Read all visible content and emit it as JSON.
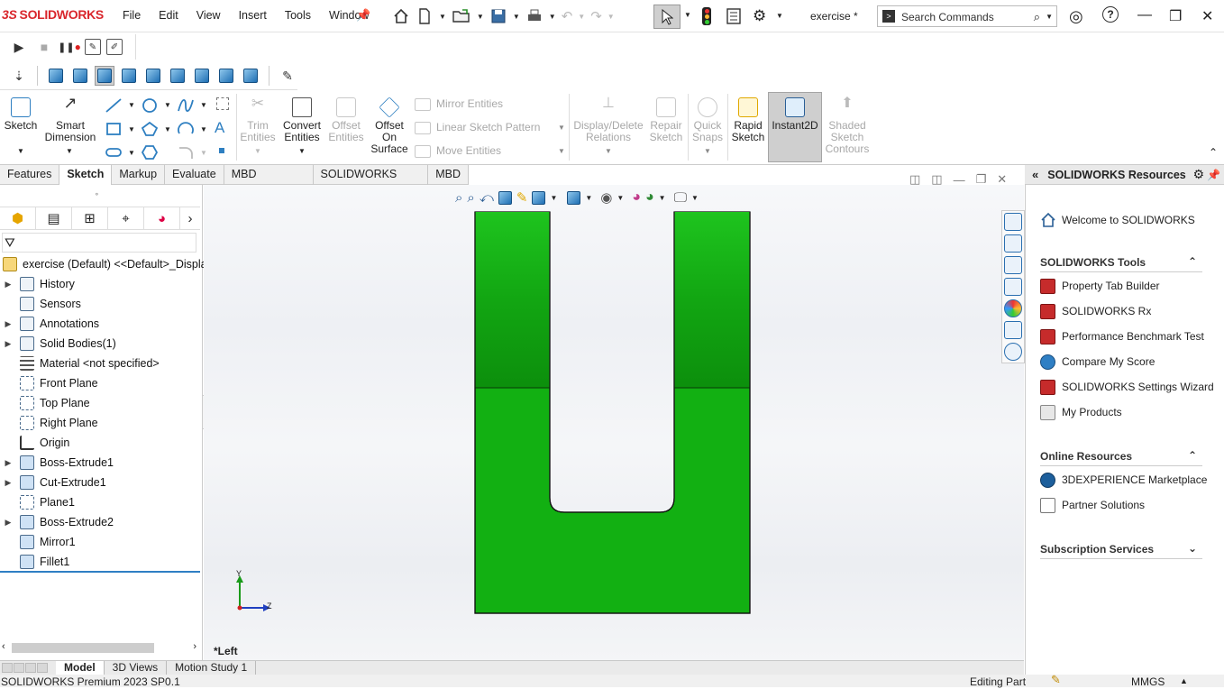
{
  "app": {
    "brand": "SOLIDWORKS",
    "brand_prefix": "3S",
    "document_title": "exercise *"
  },
  "menu": [
    "File",
    "Edit",
    "View",
    "Insert",
    "Tools",
    "Window"
  ],
  "search": {
    "placeholder": "Search Commands"
  },
  "command_manager": {
    "sketch": "Sketch",
    "smart_dimension": [
      "Smart",
      "Dimension"
    ],
    "trim_entities": [
      "Trim",
      "Entities"
    ],
    "convert_entities": [
      "Convert",
      "Entities"
    ],
    "offset_entities": [
      "Offset",
      "Entities"
    ],
    "offset_on_surface": [
      "Offset",
      "On",
      "Surface"
    ],
    "mirror_entities": "Mirror Entities",
    "linear_sketch_pattern": "Linear Sketch Pattern",
    "move_entities": "Move Entities",
    "display_delete_relations": [
      "Display/Delete",
      "Relations"
    ],
    "repair_sketch": [
      "Repair",
      "Sketch"
    ],
    "quick_snaps": [
      "Quick",
      "Snaps"
    ],
    "rapid_sketch": [
      "Rapid",
      "Sketch"
    ],
    "instant2d": "Instant2D",
    "shaded_sketch_contours": [
      "Shaded",
      "Sketch",
      "Contours"
    ]
  },
  "tabs": [
    "Features",
    "Sketch",
    "Markup",
    "Evaluate",
    "MBD Dimensions",
    "SOLIDWORKS Add-Ins",
    "MBD"
  ],
  "active_tab": "Sketch",
  "feature_tree": {
    "root": "exercise (Default) <<Default>_Display",
    "items": [
      {
        "label": "History",
        "expandable": true
      },
      {
        "label": "Sensors",
        "expandable": false
      },
      {
        "label": "Annotations",
        "expandable": true
      },
      {
        "label": "Solid Bodies(1)",
        "expandable": true
      },
      {
        "label": "Material <not specified>",
        "expandable": false
      },
      {
        "label": "Front Plane",
        "expandable": false
      },
      {
        "label": "Top Plane",
        "expandable": false
      },
      {
        "label": "Right Plane",
        "expandable": false
      },
      {
        "label": "Origin",
        "expandable": false
      },
      {
        "label": "Boss-Extrude1",
        "expandable": true
      },
      {
        "label": "Cut-Extrude1",
        "expandable": true
      },
      {
        "label": "Plane1",
        "expandable": false
      },
      {
        "label": "Boss-Extrude2",
        "expandable": true
      },
      {
        "label": "Mirror1",
        "expandable": false
      },
      {
        "label": "Fillet1",
        "expandable": false
      }
    ]
  },
  "viewport": {
    "view_label": "*Left",
    "axis_y": "Y",
    "axis_z": "Z",
    "part_color": "#12b012"
  },
  "bottom_tabs": [
    "Model",
    "3D Views",
    "Motion Study 1"
  ],
  "active_bottom_tab": "Model",
  "status": {
    "product": "SOLIDWORKS Premium 2023 SP0.1",
    "mode": "Editing Part",
    "units": "MMGS"
  },
  "resources": {
    "title": "SOLIDWORKS Resources",
    "welcome": "Welcome to SOLIDWORKS",
    "tools_title": "SOLIDWORKS Tools",
    "tools": [
      "Property Tab Builder",
      "SOLIDWORKS Rx",
      "Performance Benchmark Test",
      "Compare My Score",
      "SOLIDWORKS Settings Wizard",
      "My Products"
    ],
    "online_title": "Online Resources",
    "online": [
      "3DEXPERIENCE Marketplace",
      "Partner Solutions"
    ],
    "subscription_title": "Subscription Services"
  }
}
